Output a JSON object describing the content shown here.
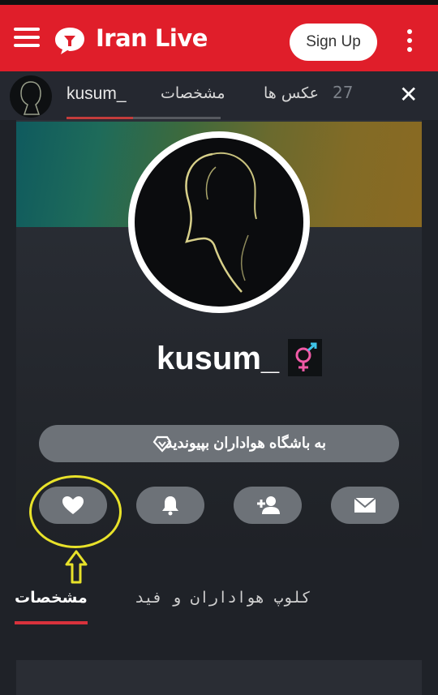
{
  "header": {
    "brand": "Iran Live",
    "signup_label": "Sign Up",
    "colors": {
      "bar": "#e01e2a",
      "button_bg": "#ffffff"
    }
  },
  "subbar": {
    "username": "kusum_",
    "tab_profile": "مشخصات",
    "tab_photos": "عکس ها",
    "photos_count": "27",
    "close_label": "✕"
  },
  "profile": {
    "name": "kusum_",
    "gender_icon": "gender-icon",
    "club_button_label": "به باشگاه هواداران بپیوندید",
    "actions": [
      {
        "name": "like",
        "icon": "heart-icon"
      },
      {
        "name": "notify",
        "icon": "bell-icon"
      },
      {
        "name": "follow",
        "icon": "add-user-icon"
      },
      {
        "name": "message",
        "icon": "envelope-icon"
      }
    ]
  },
  "tabs": {
    "active": "مشخصات",
    "other": "کلوپ هواداران و فید"
  }
}
